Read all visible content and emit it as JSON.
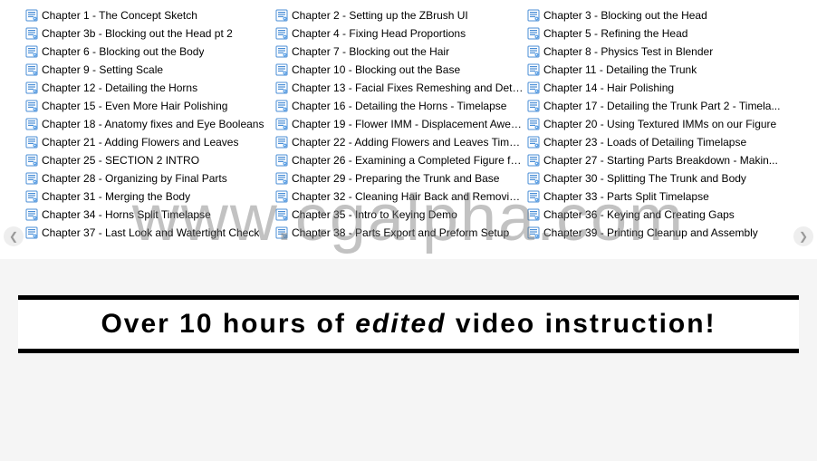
{
  "watermark": "www.cgalpha.com",
  "banner": {
    "prefix": "Over 10 hours of ",
    "emph": "edited",
    "suffix": " video instruction!"
  },
  "columns": [
    [
      "Chapter 1 - The Concept Sketch",
      "Chapter 3b - Blocking out the Head pt 2",
      "Chapter 6 - Blocking out the Body",
      "Chapter 9 - Setting Scale",
      "Chapter 12 - Detailing the Horns",
      "Chapter 15 - Even More Hair Polishing",
      "Chapter 18 - Anatomy fixes and Eye Booleans",
      "Chapter 21 - Adding Flowers and Leaves",
      "Chapter 25 - SECTION 2 INTRO",
      "Chapter 28 - Organizing by Final Parts",
      "Chapter 31 - Merging the Body",
      "Chapter 34 - Horns Split Timelapse",
      "Chapter 37 - Last Look and Watertight Check"
    ],
    [
      "Chapter 2 - Setting up the ZBrush UI",
      "Chapter 4 - Fixing Head Proportions",
      "Chapter 7 - Blocking out the Hair",
      "Chapter 10 - Blocking out the Base",
      "Chapter 13 - Facial Fixes Remeshing and Detail...",
      "Chapter 16 - Detailing the Horns - Timelapse",
      "Chapter 19 - Flower IMM - Displacement Awes...",
      "Chapter 22 - Adding Flowers and Leaves Timel...",
      "Chapter 26 - Examining a Completed Figure fo...",
      "Chapter 29 - Preparing the Trunk and Base",
      "Chapter 32 - Cleaning Hair Back and Removin...",
      "Chapter 35 - Intro to Keying Demo",
      "Chapter 38 - Parts Export and Preform Setup"
    ],
    [
      "Chapter 3 - Blocking out the Head",
      "Chapter 5 - Refining the Head",
      "Chapter 8 - Physics Test in Blender",
      "Chapter 11 - Detailing the Trunk",
      "Chapter 14 - Hair Polishing",
      "Chapter 17 - Detailing the Trunk Part 2 - Timela...",
      "Chapter 20 - Using Textured IMMs on our Figure",
      "Chapter 23 - Loads of Detailing Timelapse",
      "Chapter 27 - Starting Parts Breakdown - Makin...",
      "Chapter 30 - Splitting The Trunk and Body",
      "Chapter 33 - Parts Split Timelapse",
      "Chapter 36 - Keying and Creating Gaps",
      "Chapter 39 - Printing Cleanup and Assembly"
    ]
  ]
}
